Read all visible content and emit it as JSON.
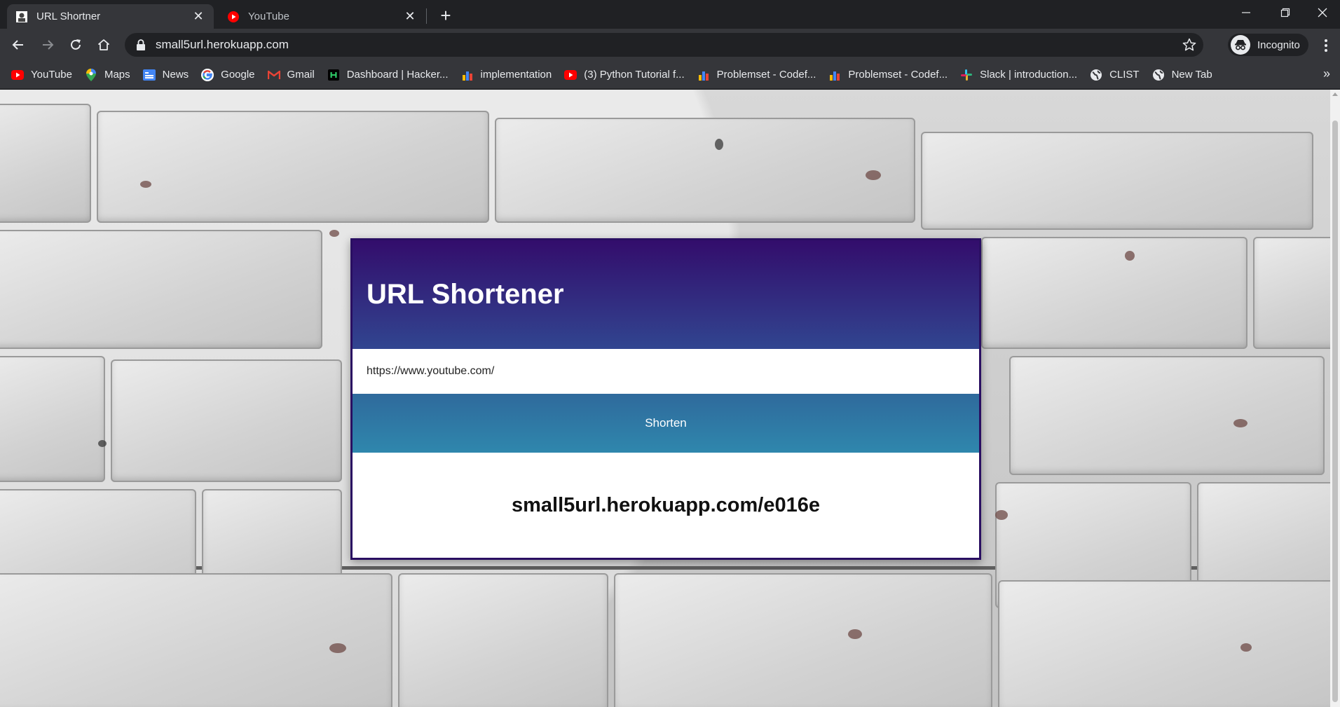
{
  "tabs": [
    {
      "title": "URL Shortner",
      "active": true
    },
    {
      "title": "YouTube",
      "active": false
    }
  ],
  "toolbar": {
    "url": "small5url.herokuapp.com",
    "profile_label": "Incognito"
  },
  "bookmarks": [
    {
      "label": "YouTube",
      "icon": "youtube-icon"
    },
    {
      "label": "Maps",
      "icon": "maps-icon"
    },
    {
      "label": "News",
      "icon": "news-icon"
    },
    {
      "label": "Google",
      "icon": "google-icon"
    },
    {
      "label": "Gmail",
      "icon": "gmail-icon"
    },
    {
      "label": "Dashboard | Hacker...",
      "icon": "hackerrank-icon"
    },
    {
      "label": "implementation",
      "icon": "bar-chart-icon"
    },
    {
      "label": "(3) Python Tutorial f...",
      "icon": "youtube-icon"
    },
    {
      "label": "Problemset - Codef...",
      "icon": "bar-chart-icon"
    },
    {
      "label": "Problemset - Codef...",
      "icon": "bar-chart-icon"
    },
    {
      "label": "Slack | introduction...",
      "icon": "slack-icon"
    },
    {
      "label": "CLIST",
      "icon": "globe-icon"
    },
    {
      "label": "New Tab",
      "icon": "globe-icon"
    }
  ],
  "app": {
    "title": "URL Shortener",
    "input_value": "https://www.youtube.com/",
    "button_label": "Shorten",
    "result": "small5url.herokuapp.com/e016e"
  },
  "colors": {
    "header_top": "#330d6c",
    "header_bottom": "#314590",
    "button_top": "#2f6a9c",
    "button_bottom": "#2f87ad",
    "chrome_dark": "#202124",
    "chrome_toolbar": "#35363a"
  }
}
